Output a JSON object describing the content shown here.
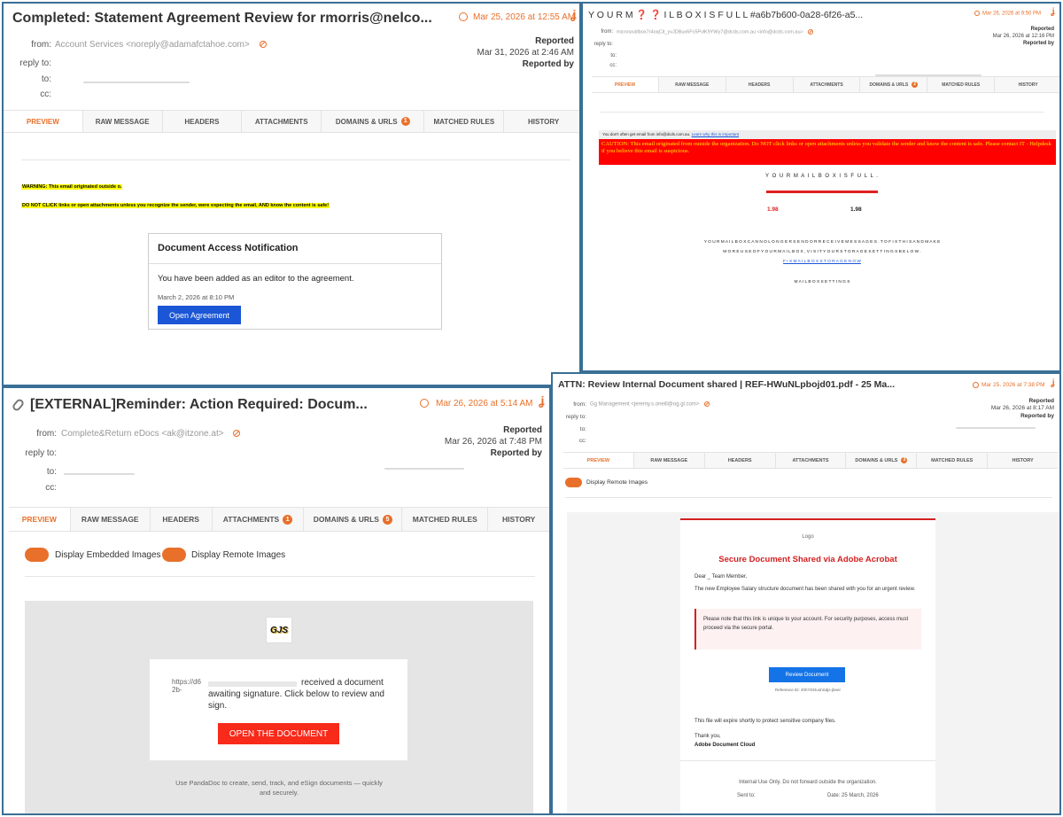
{
  "p1": {
    "title": "Completed: Statement Agreement Review for rmorris@nelco...",
    "date": "Mar 25, 2026 at 12:55 AM",
    "from_label": "from:",
    "from_value": "Account Services <noreply@adamafctahoe.com>",
    "reply_label": "reply to:",
    "to_label": "to:",
    "cc_label": "cc:",
    "reported": "Reported",
    "reported_date": "Mar 31, 2026 at 2:46 AM",
    "reported_by": "Reported by",
    "tabs": [
      "PREVIEW",
      "RAW MESSAGE",
      "HEADERS",
      "ATTACHMENTS",
      "DOMAINS & URLS",
      "MATCHED RULES",
      "HISTORY"
    ],
    "domains_badge": "1",
    "warning1": "WARNING: This email originated outside o.",
    "warning2": "DO NOT CLICK links or open attachments unless you recognize the sender, were expecting the email, AND know the content is safe!",
    "card_title": "Document Access Notification",
    "card_body": "You have been added as an editor to the agreement.",
    "card_date": "March 2, 2026 at 8:10 PM",
    "card_button": "Open Agreement"
  },
  "p2": {
    "title": "Y O U R M ❓ ❓ I L B O X I S F U L L #a6b7b600-0a28-6f26-a5...",
    "date": "Mar 26, 2026 at 9:50 PM",
    "from_label": "from:",
    "from_value": "microsnallbox7r4oqCit_yvJDBux6Fc5PvlK9YWy7@dcds.com.au <info@dcds.com.au>",
    "reply_label": "reply to:",
    "to_label": "to:",
    "cc_label": "cc:",
    "reported": "Reported",
    "reported_date": "Mar 26, 2026 at 12:16 PM",
    "reported_by": "Reported by",
    "tabs": [
      "PREVIEW",
      "RAW MESSAGE",
      "HEADERS",
      "ATTACHMENTS",
      "DOMAINS & URLS",
      "MATCHED RULES",
      "HISTORY"
    ],
    "domains_badge": "2",
    "notice": "You don't often get email from info@dcds.com.au.",
    "notice_link": "Learn why this is important",
    "caution": "CAUTION: This email originated from outside the organization. Do NOT click links or open attachments unless you validate the sender and know the content is safe. Please contact IT - Helpdesk if you believe this email is suspicious.",
    "mailbox_heading": "Y O U R M A I L B O X I S F U L L .",
    "storage_left": "1.98",
    "storage_right": "1.98",
    "body_line1": "Y O U R M A I L B O X C A N N O L O N G E R S E N D O R R E C E I V E M E S S A G E S . T O F I X T H I S A N D M A K E",
    "body_line2": "M O R E U S E O F Y O U R M A I L B O X , V I S I T Y O U R S T O R A G E S E T T I N G S B E L O W .",
    "body_link": "F I X M A I L B O X S T O R A G E N O W",
    "footer_line": "M A I L B O X S E T T I N G S"
  },
  "p3": {
    "title": "[EXTERNAL]Reminder: Action Required: Docum...",
    "date": "Mar 26, 2026 at 5:14 AM",
    "from_label": "from:",
    "from_value": "Complete&Return eDocs <ak@itzone.at>",
    "reply_label": "reply to:",
    "to_label": "to:",
    "cc_label": "cc:",
    "reported": "Reported",
    "reported_date": "Mar 26, 2026 at 7:48 PM",
    "reported_by": "Reported by",
    "tabs": [
      "PREVIEW",
      "RAW MESSAGE",
      "HEADERS",
      "ATTACHMENTS",
      "DOMAINS & URLS",
      "MATCHED RULES",
      "HISTORY"
    ],
    "attachments_badge": "1",
    "domains_badge": "5",
    "toggle1_label": "Display Embedded Images",
    "toggle2_label": "Display Remote Images",
    "logo_text": "GJS",
    "broken_img_text": "https://d62b-",
    "doc_text": "received a document awaiting signature. Click below to review and sign.",
    "doc_button": "OPEN THE DOCUMENT",
    "footer": "Use PandaDoc to create, send, track, and eSign documents — quickly and securely."
  },
  "p4": {
    "title": "ATTN: Review Internal Document shared | REF-HWuNLpbojd01.pdf - 25 Ma...",
    "date": "Mar 25, 2026 at 7:38 PM",
    "from_label": "from:",
    "from_value": "Gg Management <jeremy.s.oneill@og.gl.com>",
    "reply_label": "reply to:",
    "to_label": "to:",
    "cc_label": "cc:",
    "reported": "Reported",
    "reported_date": "Mar 26, 2026 at 8:17 AM",
    "reported_by": "Reported by",
    "tabs": [
      "PREVIEW",
      "RAW MESSAGE",
      "HEADERS",
      "ATTACHMENTS",
      "DOMAINS & URLS",
      "MATCHED RULES",
      "HISTORY"
    ],
    "domains_badge": "3",
    "toggle_label": "Display Remote Images",
    "logo_alt": "Logo",
    "heading": "Secure Document Shared via Adobe Acrobat",
    "greeting": "Dear _ Team Member,",
    "para1": "The new Employee Salary structure document has been shared with you for an urgent review.",
    "note": "Please note that this link is unique to your account. For security purposes, access must proceed via the secure portal.",
    "button": "Review Document",
    "reference": "Reference ID: 4hhYDOuohSdjs-jbeer",
    "expire": "This file will expire shortly to protect sensitive company files.",
    "thanks": "Thank you,",
    "signature": "Adobe Document Cloud",
    "internal": "Internal Use Only. Do not forward outside the organization.",
    "sent_to": "Sent to:",
    "sent_date": "Date: 25 March, 2026"
  }
}
